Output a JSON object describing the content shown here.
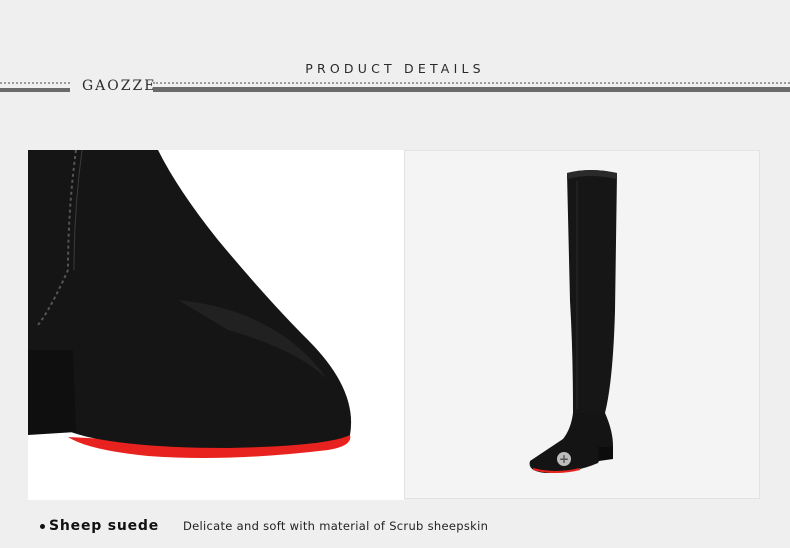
{
  "header": {
    "title": "PRODUCT DETAILS",
    "brand": "GAOZZE"
  },
  "images": {
    "closeup": {
      "subject": "suede boot toe close-up with red sole"
    },
    "full": {
      "subject": "over-the-knee black suede boot, side view",
      "icon": "plus-circle-icon"
    }
  },
  "caption": {
    "title": "Sheep suede",
    "description": "Delicate and soft with material of Scrub sheepskin"
  },
  "colors": {
    "suede": "#151515",
    "sole": "#e8231f",
    "background": "#efefef"
  }
}
